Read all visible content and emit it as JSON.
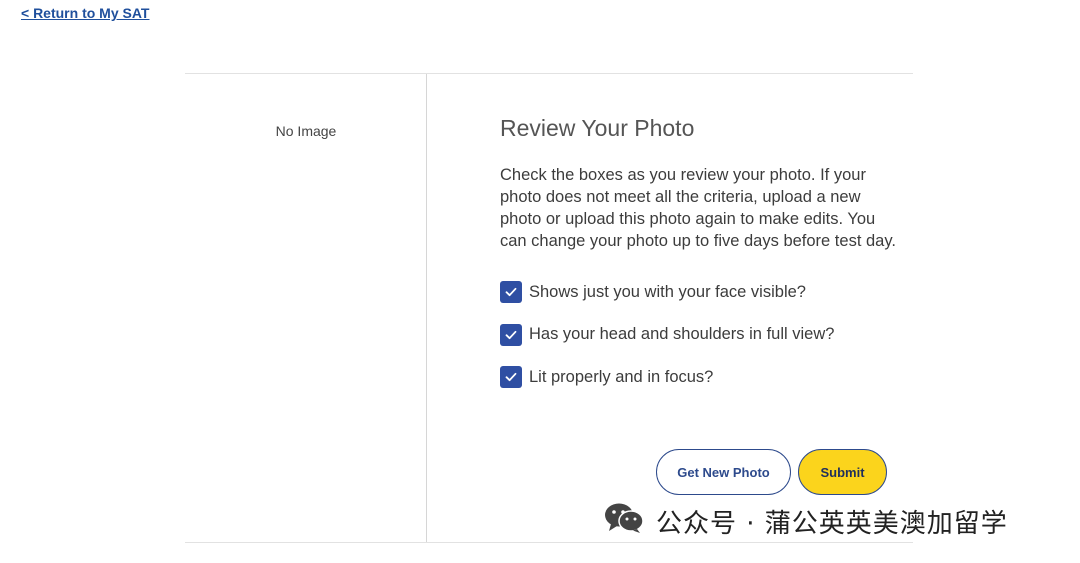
{
  "nav": {
    "return_link": "< Return to My SAT"
  },
  "photo": {
    "placeholder": "No Image"
  },
  "review": {
    "title": "Review Your Photo",
    "instructions": "Check the boxes as you review your photo. If your photo does not meet all the criteria, upload a new photo or upload this photo again to make edits. You can change your photo up to five days before test day.",
    "criteria": [
      {
        "label": "Shows just you with your face visible?",
        "checked": true
      },
      {
        "label": "Has your head and shoulders in full view?",
        "checked": true
      },
      {
        "label": "Lit properly and in focus?",
        "checked": true
      }
    ]
  },
  "actions": {
    "get_new_photo": "Get New Photo",
    "submit": "Submit"
  },
  "watermark": {
    "text": "公众号 · 蒲公英英美澳加留学",
    "icon": "wechat-icon"
  },
  "colors": {
    "link": "#1f4f9c",
    "checkbox": "#2f4fa3",
    "submit_bg": "#fbd41c",
    "button_border": "#2d4a8c"
  }
}
